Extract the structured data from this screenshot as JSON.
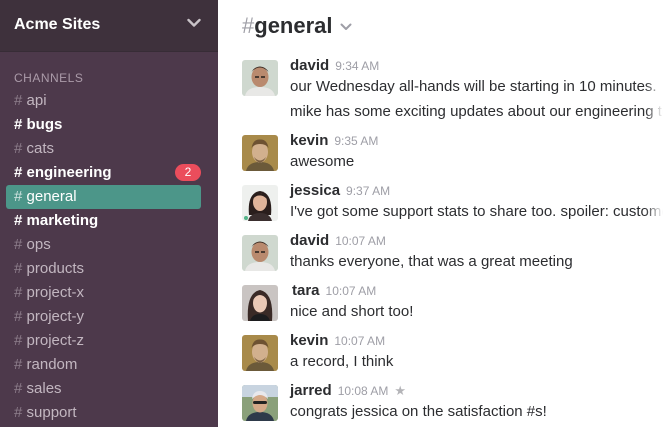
{
  "team": {
    "name": "Acme Sites"
  },
  "sidebar": {
    "channels_heading": "CHANNELS",
    "channels": [
      {
        "hash": "#",
        "name": "api",
        "state": "normal"
      },
      {
        "hash": "#",
        "name": "bugs",
        "state": "unread"
      },
      {
        "hash": "#",
        "name": "cats",
        "state": "normal"
      },
      {
        "hash": "#",
        "name": "engineering",
        "state": "unread",
        "badge": "2"
      },
      {
        "hash": "#",
        "name": "general",
        "state": "active"
      },
      {
        "hash": "#",
        "name": "marketing",
        "state": "unread"
      },
      {
        "hash": "#",
        "name": "ops",
        "state": "normal"
      },
      {
        "hash": "#",
        "name": "products",
        "state": "normal"
      },
      {
        "hash": "#",
        "name": "project-x",
        "state": "normal"
      },
      {
        "hash": "#",
        "name": "project-y",
        "state": "normal"
      },
      {
        "hash": "#",
        "name": "project-z",
        "state": "normal"
      },
      {
        "hash": "#",
        "name": "random",
        "state": "normal"
      },
      {
        "hash": "#",
        "name": "sales",
        "state": "normal"
      },
      {
        "hash": "#",
        "name": "support",
        "state": "normal"
      }
    ]
  },
  "header": {
    "hash": "#",
    "channel": "general"
  },
  "messages": [
    {
      "author": "david",
      "time": "9:34 AM",
      "lines": [
        "our Wednesday all-hands will be starting in 10 minutes.",
        "mike has some exciting updates about our engineering team"
      ],
      "avatar": "avatar-david"
    },
    {
      "author": "kevin",
      "time": "9:35 AM",
      "lines": [
        "awesome"
      ],
      "avatar": "avatar-kevin"
    },
    {
      "author": "jessica",
      "time": "9:37 AM",
      "lines": [
        "I've got some support stats to share too. spoiler: customer satisfaction"
      ],
      "avatar": "avatar-jessica"
    },
    {
      "author": "david",
      "time": "10:07 AM",
      "lines": [
        "thanks everyone, that was a great meeting"
      ],
      "avatar": "avatar-david"
    },
    {
      "author": "tara",
      "time": "10:07 AM",
      "lines": [
        "nice and short too!"
      ],
      "avatar": "avatar-tara"
    },
    {
      "author": "kevin",
      "time": "10:07 AM",
      "lines": [
        "a record, I think"
      ],
      "avatar": "avatar-kevin"
    },
    {
      "author": "jarred",
      "time": "10:08 AM",
      "lines": [
        "congrats jessica on the satisfaction #s!"
      ],
      "avatar": "avatar-jarred",
      "starred": true
    }
  ],
  "colors": {
    "sidebar": "#4d394b",
    "team_header": "#3e313c",
    "active": "#4c9689",
    "badge": "#eb4d5c"
  }
}
